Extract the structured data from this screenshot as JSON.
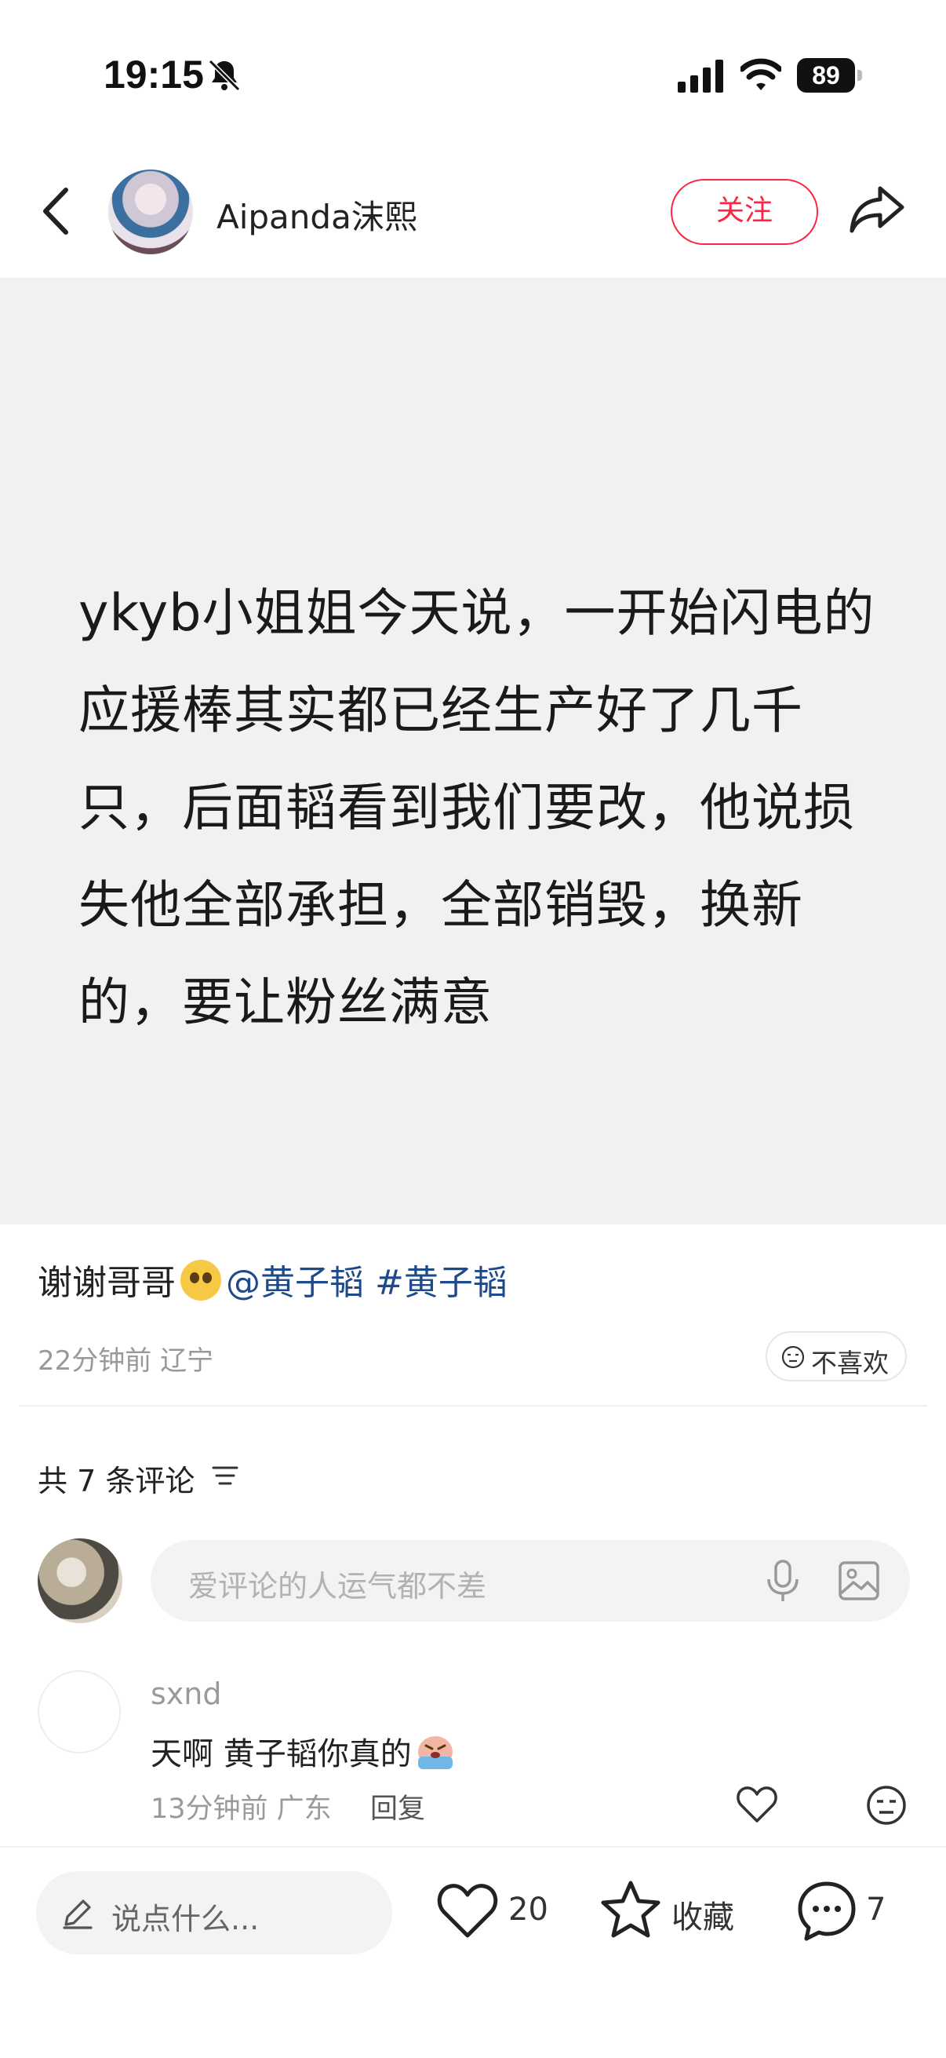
{
  "status_bar": {
    "time": "19:15",
    "battery": "89"
  },
  "header": {
    "author": "Aipanda沫熙",
    "follow_label": "关注"
  },
  "post": {
    "card_text": "ykyb小姐姐今天说，一开始闪电的应援棒其实都已经生产好了几千只，后面韬看到我们要改，他说损失他全部承担，全部销毁，换新的，要让粉丝满意",
    "caption_text": "谢谢哥哥",
    "mention": "@黄子韬",
    "hashtag": "#黄子韬",
    "time_location": "22分钟前 辽宁",
    "dislike_label": "不喜欢"
  },
  "comments": {
    "count_label": "共 7 条评论",
    "input_placeholder": "爱评论的人运气都不差",
    "items": [
      {
        "user": "sxnd",
        "text": "天啊 黄子韬你真的",
        "time_location": "13分钟前 广东",
        "reply_label": "回复"
      }
    ]
  },
  "bottom_bar": {
    "say_placeholder": "说点什么...",
    "likes": "20",
    "favorite_label": "收藏",
    "comments": "7"
  },
  "icons": [
    "back-icon",
    "bell-off-icon",
    "signal-icon",
    "wifi-icon",
    "battery-icon",
    "share-icon",
    "sort-icon",
    "mic-icon",
    "image-icon",
    "heart-icon",
    "star-icon",
    "comment-icon",
    "pencil-icon",
    "neutral-face-icon"
  ],
  "colors": {
    "accent": "#ff2442",
    "tag": "#1e4a8a",
    "card_bg": "#f1f1f1"
  }
}
